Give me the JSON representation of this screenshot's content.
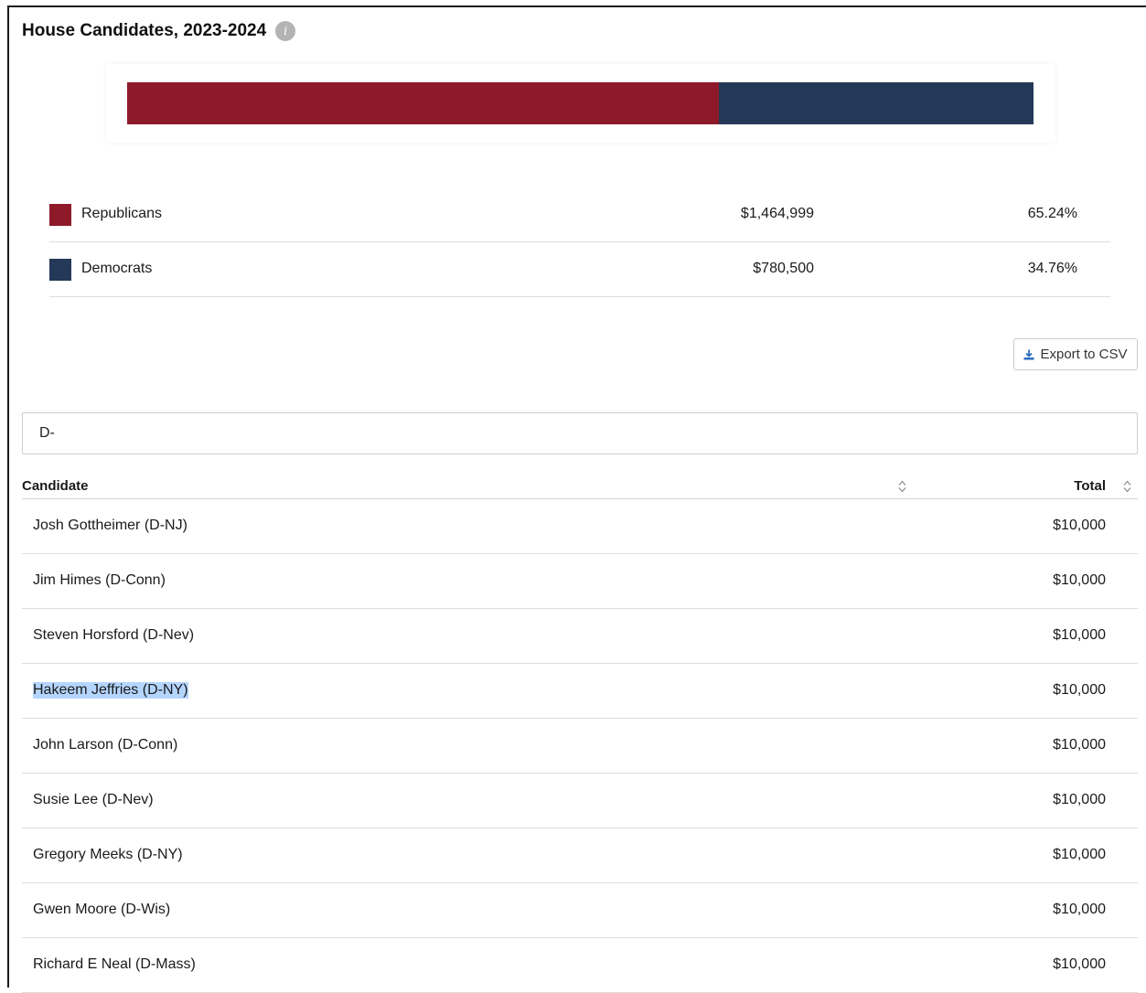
{
  "header": {
    "title": "House Candidates, 2023-2024",
    "info_icon": "info-icon"
  },
  "colors": {
    "republicans": "#8e1a29",
    "democrats": "#243958"
  },
  "chart_data": {
    "type": "bar",
    "stacked": true,
    "orientation": "horizontal",
    "series": [
      {
        "name": "Republicans",
        "value": 1464999,
        "percent": 65.24
      },
      {
        "name": "Democrats",
        "value": 780500,
        "percent": 34.76
      }
    ]
  },
  "legend": [
    {
      "name": "Republicans",
      "amount": "$1,464,999",
      "percent": "65.24%",
      "color": "#8e1a29"
    },
    {
      "name": "Democrats",
      "amount": "$780,500",
      "percent": "34.76%",
      "color": "#243958"
    }
  ],
  "export": {
    "label": "Export to CSV",
    "icon": "download-icon"
  },
  "filter": {
    "value": "D-"
  },
  "table": {
    "columns": {
      "candidate": "Candidate",
      "total": "Total"
    },
    "rows": [
      {
        "candidate": "Josh Gottheimer (D-NJ)",
        "total": "$10,000"
      },
      {
        "candidate": "Jim Himes (D-Conn)",
        "total": "$10,000"
      },
      {
        "candidate": "Steven Horsford (D-Nev)",
        "total": "$10,000"
      },
      {
        "candidate": "Hakeem Jeffries (D-NY)",
        "total": "$10,000",
        "selected": true
      },
      {
        "candidate": "John Larson (D-Conn)",
        "total": "$10,000"
      },
      {
        "candidate": "Susie Lee (D-Nev)",
        "total": "$10,000"
      },
      {
        "candidate": "Gregory Meeks (D-NY)",
        "total": "$10,000"
      },
      {
        "candidate": "Gwen Moore (D-Wis)",
        "total": "$10,000"
      },
      {
        "candidate": "Richard E Neal (D-Mass)",
        "total": "$10,000"
      }
    ]
  }
}
